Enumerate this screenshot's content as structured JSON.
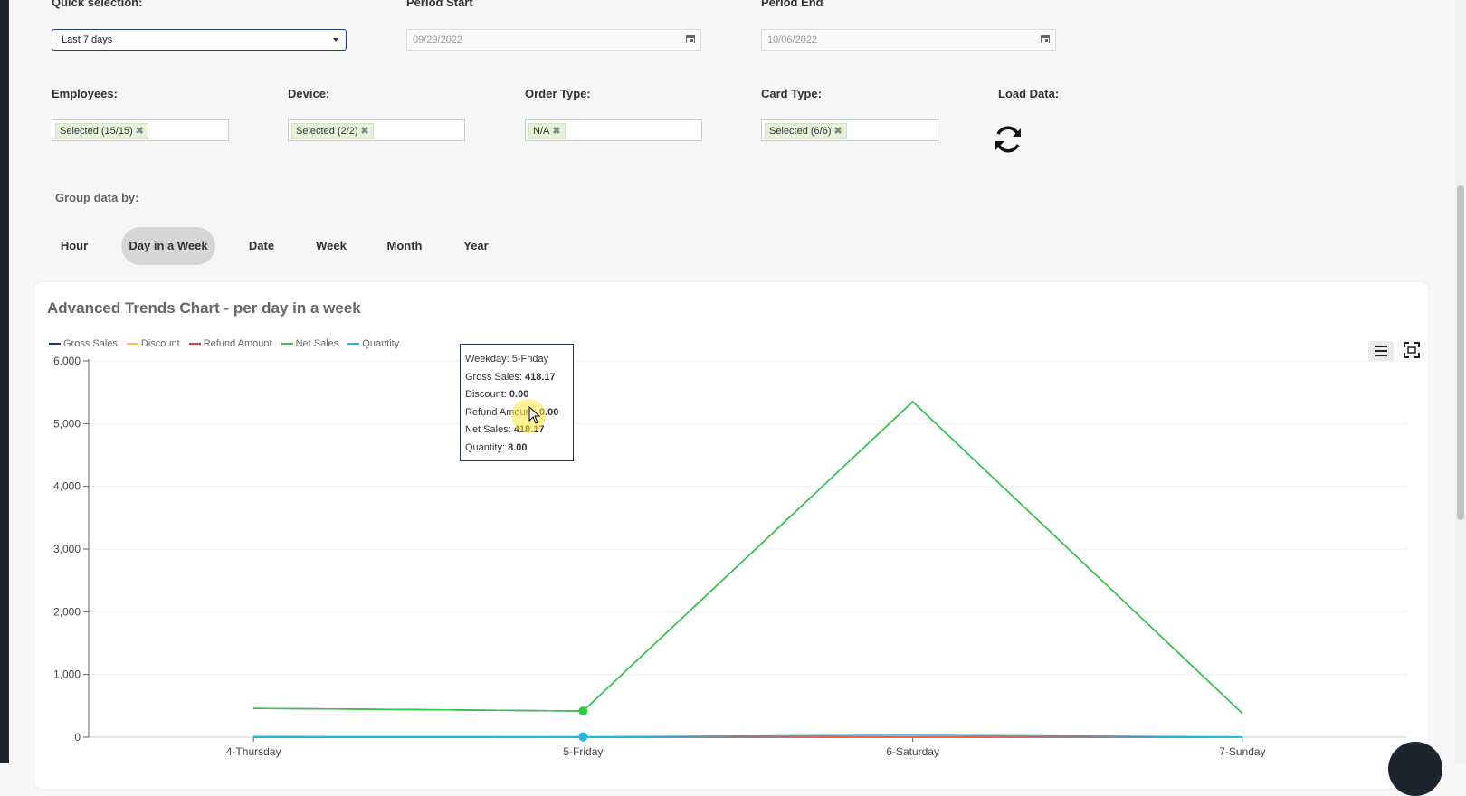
{
  "filters": {
    "quick_selection": {
      "label": "Quick selection:",
      "value": "Last 7 days"
    },
    "period_start": {
      "label": "Period Start",
      "value": "09/29/2022"
    },
    "period_end": {
      "label": "Period End",
      "value": "10/06/2022"
    },
    "employees": {
      "label": "Employees:",
      "tag": "Selected (15/15)"
    },
    "device": {
      "label": "Device:",
      "tag": "Selected (2/2)"
    },
    "order_type": {
      "label": "Order Type:",
      "tag": "N/A"
    },
    "card_type": {
      "label": "Card Type:",
      "tag": "Selected (6/6)"
    },
    "load_data": {
      "label": "Load Data:",
      "icon": "refresh-icon"
    }
  },
  "group": {
    "label": "Group data by:",
    "buttons": [
      "Hour",
      "Day in a Week",
      "Date",
      "Week",
      "Month",
      "Year"
    ],
    "active": "Day in a Week"
  },
  "chart_title": "Advanced Trends Chart - per day in a week",
  "tooltip": {
    "weekday_label": "Weekday:",
    "weekday_value": "5-Friday",
    "gross_label": "Gross Sales:",
    "gross_value": "418.17",
    "discount_label": "Discount:",
    "discount_value": "0.00",
    "refund_label": "Refund Amount:",
    "refund_value": "0.00",
    "net_label": "Net Sales:",
    "net_value": "418.17",
    "qty_label": "Quantity:",
    "qty_value": "8.00"
  },
  "toolbar": {
    "menu_icon": "hamburger-menu-icon",
    "fullscreen_icon": "fullscreen-icon"
  },
  "chart_data": {
    "type": "line",
    "title": "Advanced Trends Chart - per day in a week",
    "categories": [
      "4-Thursday",
      "5-Friday",
      "6-Saturday",
      "7-Sunday"
    ],
    "ylim": [
      0,
      6000
    ],
    "yticks": [
      0,
      1000,
      2000,
      3000,
      4000,
      5000,
      6000
    ],
    "ytick_labels": [
      "0",
      "1,000",
      "2,000",
      "3,000",
      "4,000",
      "5,000",
      "6,000"
    ],
    "grid": true,
    "legend_position": "top-left",
    "highlighted_category": "5-Friday",
    "series": [
      {
        "name": "Gross Sales",
        "color": "#1f3a5f",
        "values": [
          460,
          418.17,
          5350,
          380
        ]
      },
      {
        "name": "Discount",
        "color": "#f4c542",
        "values": [
          0,
          0,
          0,
          0
        ]
      },
      {
        "name": "Refund Amount",
        "color": "#e53935",
        "values": [
          0,
          0,
          0,
          0
        ]
      },
      {
        "name": "Net Sales",
        "color": "#2ecc40",
        "values": [
          460,
          418.17,
          5350,
          380
        ]
      },
      {
        "name": "Quantity",
        "color": "#29b6d6",
        "values": [
          10,
          8,
          30,
          6
        ]
      }
    ]
  }
}
